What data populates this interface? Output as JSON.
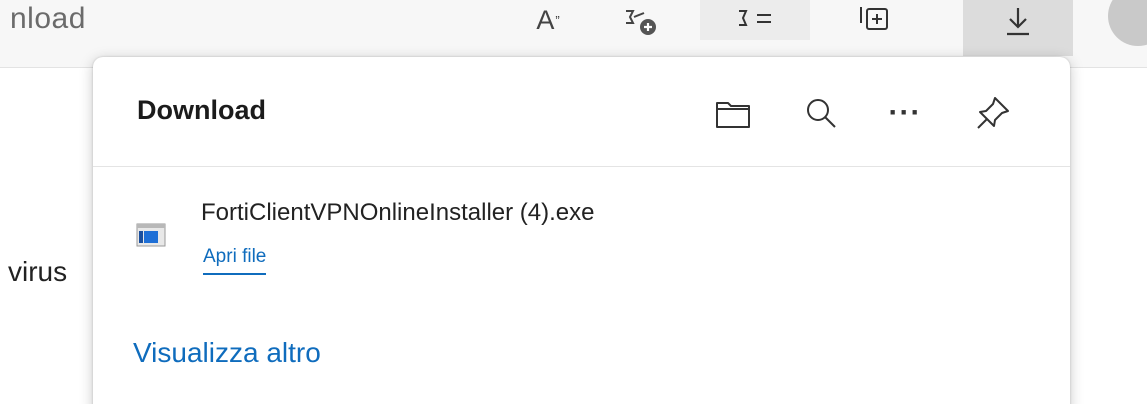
{
  "toolbar": {
    "page_title_fragment": "nload",
    "read_aloud_glyph": "A",
    "read_aloud_sup": "”",
    "icons": [
      "add-favorite-icon",
      "favorites-icon",
      "collections-icon",
      "download-icon",
      "profile-avatar"
    ]
  },
  "page": {
    "body_fragment": "virus"
  },
  "downloads": {
    "title": "Download",
    "header_buttons": [
      "folder-icon",
      "search-icon",
      "more-icon",
      "pin-icon"
    ],
    "more_glyph": "···",
    "items": [
      {
        "filename": "FortiClientVPNOnlineInstaller (4).exe",
        "action": "Apri file"
      }
    ],
    "see_more": "Visualizza altro"
  },
  "colors": {
    "accent": "#0f6cbd",
    "toolbar_bg": "#f7f7f7",
    "active_button_bg": "#dcdcdc"
  }
}
